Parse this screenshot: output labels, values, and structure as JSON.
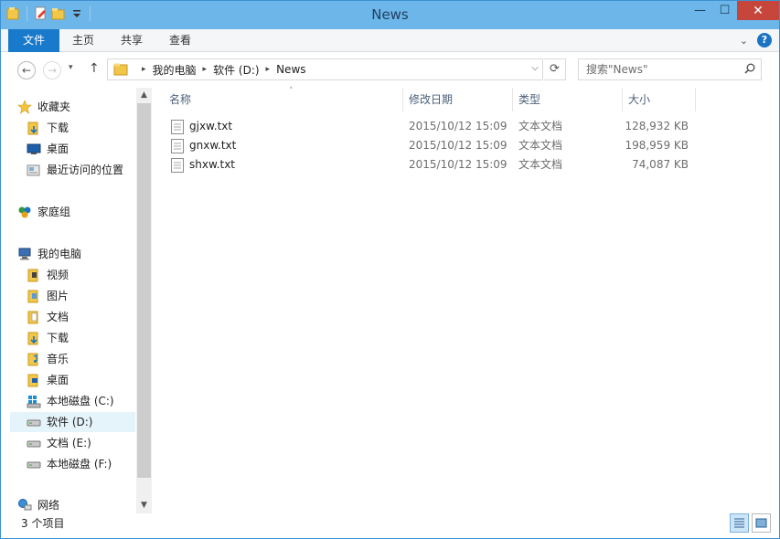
{
  "window": {
    "title": "News"
  },
  "title_bar": {
    "quick_access_icons": [
      "properties-folder-icon",
      "new-note-icon",
      "new-folder-icon",
      "customize-dropdown-icon"
    ],
    "minimize": "—",
    "maximize": "☐",
    "close": "✕"
  },
  "ribbon": {
    "tabs": [
      {
        "label": "文件"
      },
      {
        "label": "主页"
      },
      {
        "label": "共享"
      },
      {
        "label": "查看"
      }
    ],
    "expand_icon": "⌄",
    "help_label": "?"
  },
  "nav": {
    "back": "←",
    "forward": "→",
    "up": "↑",
    "recent_dropdown": "▾"
  },
  "address": {
    "breadcrumb": [
      "我的电脑",
      "软件 (D:)",
      "News"
    ],
    "separator": "▸",
    "dropdown": "⌵",
    "refresh": "⟳"
  },
  "search": {
    "placeholder": "搜索\"News\""
  },
  "navpane": {
    "favorites": {
      "label": "收藏夹",
      "items": [
        "下载",
        "桌面",
        "最近访问的位置"
      ]
    },
    "homegroup": {
      "label": "家庭组"
    },
    "computer": {
      "label": "我的电脑",
      "items": [
        "视频",
        "图片",
        "文档",
        "下载",
        "音乐",
        "桌面",
        "本地磁盘 (C:)",
        "软件 (D:)",
        "文档 (E:)",
        "本地磁盘 (F:)"
      ]
    },
    "network": {
      "label": "网络"
    },
    "selected": "软件 (D:)"
  },
  "filelist": {
    "columns": [
      "名称",
      "修改日期",
      "类型",
      "大小"
    ],
    "sorted_by": "名称",
    "sort_arrow": "˄",
    "files": [
      {
        "name": "gjxw.txt",
        "date": "2015/10/12 15:09",
        "type": "文本文档",
        "size": "128,932 KB"
      },
      {
        "name": "gnxw.txt",
        "date": "2015/10/12 15:09",
        "type": "文本文档",
        "size": "198,959 KB"
      },
      {
        "name": "shxw.txt",
        "date": "2015/10/12 15:09",
        "type": "文本文档",
        "size": "74,087 KB"
      }
    ]
  },
  "status": {
    "item_count": "3 个项目"
  },
  "colors": {
    "titlebar": "#6db6ea",
    "file_tab": "#1979ca",
    "close_button": "#c7463c",
    "selection": "#e5f3fb",
    "column_header_text": "#4c607a"
  }
}
